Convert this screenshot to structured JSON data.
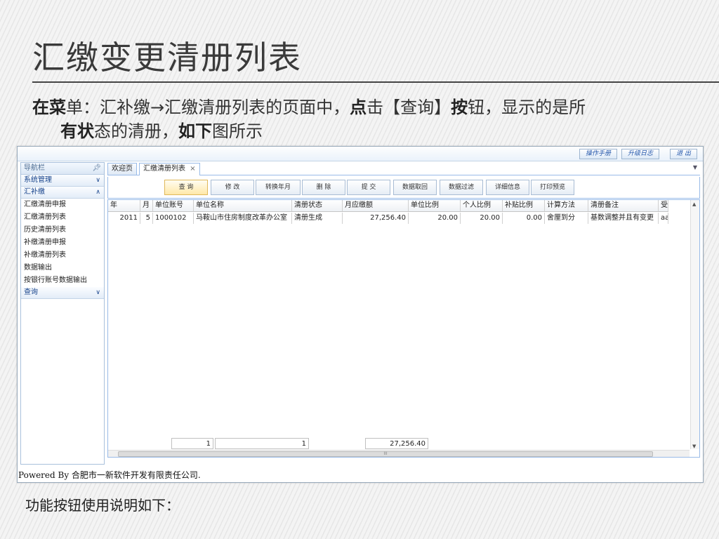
{
  "slide": {
    "title": "汇缴变更清册列表",
    "intro_line1": [
      {
        "t": "在菜",
        "b": true
      },
      {
        "t": "单：汇补缴→汇缴清册列表的页面中，",
        "b": false
      },
      {
        "t": "点",
        "b": true
      },
      {
        "t": "击【查询】",
        "b": false
      },
      {
        "t": "按",
        "b": true
      },
      {
        "t": "钮，显示的是所",
        "b": false
      }
    ],
    "intro_line2": [
      {
        "t": "有状",
        "b": true
      },
      {
        "t": "态的清册，",
        "b": false
      },
      {
        "t": "如下",
        "b": true
      },
      {
        "t": "图所示",
        "b": false
      }
    ],
    "bottom_note": "功能按钮使用说明如下："
  },
  "app": {
    "top_buttons": [
      "操作手册",
      "升级日志",
      "退 出"
    ],
    "sidebar": {
      "header": "导航栏",
      "pin_icon": "pin-icon",
      "sections": [
        {
          "label": "系统管理",
          "state": "collapsed",
          "items": []
        },
        {
          "label": "汇补缴",
          "state": "expanded",
          "items": [
            "汇缴清册申报",
            "汇缴清册列表",
            "历史清册列表",
            "补缴清册申报",
            "补缴清册列表",
            "数据输出",
            "按银行账号数据输出"
          ]
        },
        {
          "label": "查询",
          "state": "collapsed",
          "items": []
        }
      ]
    },
    "tabs": [
      {
        "label": "欢迎页",
        "active": false
      },
      {
        "label": "汇缴清册列表",
        "active": true,
        "closable": true
      }
    ],
    "toolbar": [
      "查 询",
      "修 改",
      "转换年月",
      "删 除",
      "提 交",
      "数据取回",
      "数据过滤",
      "详细信息",
      "打印预览"
    ],
    "grid": {
      "columns": [
        "年",
        "月",
        "单位账号",
        "单位名称",
        "清册状态",
        "月应缴额",
        "单位比例",
        "个人比例",
        "补贴比例",
        "计算方法",
        "清册备注",
        "受"
      ],
      "rows": [
        [
          "2011",
          "5",
          "1000102",
          "马鞍山市住房制度改革办公室",
          "清册生成",
          "27,256.40",
          "20.00",
          "20.00",
          "0.00",
          "舍厘到分",
          "基数调整并且有变更",
          "aa"
        ]
      ],
      "summary": {
        "count_a": "1",
        "count_b": "1",
        "total": "27,256.40"
      },
      "scroll_marker": "III"
    },
    "footer": "Powered By 合肥市一新软件开发有限责任公司."
  },
  "colors": {
    "accent": "#15428b",
    "border": "#99bbe8",
    "selected_button": "#ffe8a8"
  }
}
